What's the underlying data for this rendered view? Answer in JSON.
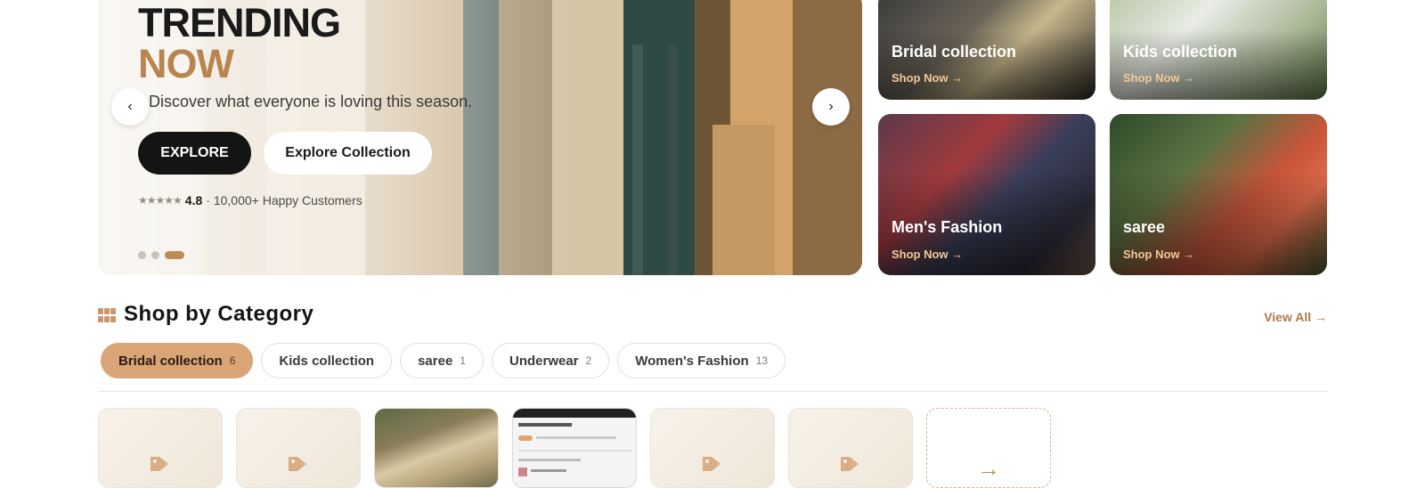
{
  "hero": {
    "title_line1": "TRENDING",
    "title_line2": "NOW",
    "subtitle": "Discover what everyone is loving this season.",
    "primary_button": "EXPLORE",
    "secondary_button": "Explore Collection",
    "stars": "★★★★★",
    "rating": "4.8",
    "rating_text": "· 10,000+ Happy Customers",
    "prev_arrow": "‹",
    "next_arrow": "›",
    "slide_count": 3,
    "active_slide": 3
  },
  "tiles": [
    {
      "title": "Bridal collection",
      "link": "Shop Now →"
    },
    {
      "title": "Kids collection",
      "link": "Shop Now →"
    },
    {
      "title": "Men's Fashion",
      "link": "Shop Now →"
    },
    {
      "title": "saree",
      "link": "Shop Now →"
    }
  ],
  "categories": {
    "heading": "Shop by Category",
    "view_all": "View All →",
    "pills": [
      {
        "label": "Bridal collection",
        "count": "6",
        "active": true
      },
      {
        "label": "Kids collection",
        "count": "",
        "active": false
      },
      {
        "label": "saree",
        "count": "1",
        "active": false
      },
      {
        "label": "Underwear",
        "count": "2",
        "active": false
      },
      {
        "label": "Women's Fashion",
        "count": "13",
        "active": false
      }
    ]
  },
  "colors": {
    "accent": "#c08a56",
    "accent_light": "#d9a577",
    "dark": "#141414"
  },
  "icons": {
    "grid": "grid-icon",
    "tag": "tag-icon",
    "more": "arrow-right-icon"
  }
}
